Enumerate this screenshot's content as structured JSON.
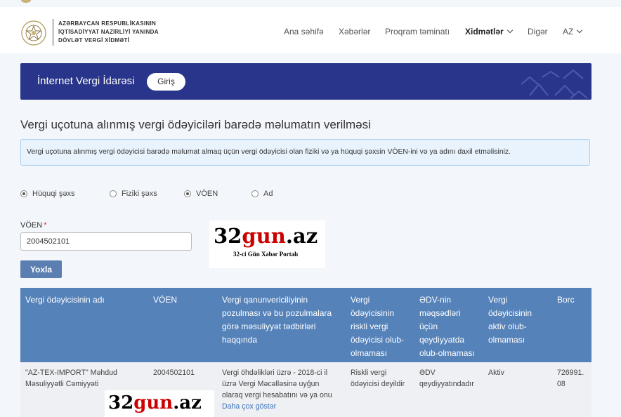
{
  "header": {
    "org_lines": [
      "AZƏRBAYCAN RESPUBLİKASININ",
      "İQTİSADİYYAT NAZİRLİYİ YANINDA",
      "DÖVLƏT VERGİ XİDMƏTİ"
    ],
    "nav": {
      "home": "Ana səhifə",
      "news": "Xəbərlər",
      "software": "Proqram təminatı",
      "services": "Xidmətlər",
      "other": "Digər",
      "language": "AZ"
    }
  },
  "banner": {
    "title": "İnternet Vergi İdarəsi",
    "login_label": "Giriş"
  },
  "page": {
    "title": "Vergi uçotuna alınmış vergi ödəyiciləri barədə məlumatın verilməsi",
    "info": "Vergi uçotuna alınmış vergi ödəyicisi barədə məlumat almaq üçün vergi ödəyicisi olan fiziki və ya hüquqi şəxsin VÖEN-ini və ya adını daxil etməlisiniz."
  },
  "filters": {
    "person_type": [
      {
        "label": "Hüquqi şəxs",
        "selected": true
      },
      {
        "label": "Fiziki şəxs",
        "selected": false
      }
    ],
    "search_by": [
      {
        "label": "VÖEN",
        "selected": true
      },
      {
        "label": "Ad",
        "selected": false
      }
    ]
  },
  "form": {
    "voen_label": "VÖEN",
    "required_mark": "*",
    "voen_value": "2004502101",
    "check_button": "Yoxla"
  },
  "watermark": {
    "brand_black": "32",
    "brand_red": "gun",
    "brand_tld": ".az",
    "tagline": "32-ci Gün Xəbər Portalı"
  },
  "table": {
    "headers": {
      "name": "Vergi ödəyicisinin adı",
      "voen": "VÖEN",
      "violation": [
        "Vergi qanunvericiliyinin",
        "pozulması və bu pozulmalara",
        "görə məsuliyyət tədbirləri",
        "haqqında"
      ],
      "risky": [
        "Vergi",
        "ödəyicisinin",
        "riskli vergi",
        "ödəyicisi olub-",
        "olmaması"
      ],
      "vat": [
        "ƏDV-nin",
        "məqsədləri",
        "üçün",
        "qeydiyyatda",
        "olub-olmaması"
      ],
      "active": [
        "Vergi",
        "ödəyicisinin",
        "aktiv olub-",
        "olmaması"
      ],
      "debt": "Borc"
    },
    "rows": [
      {
        "name": [
          "\"AZ-TEX-IMPORT\" Məhdud",
          "Məsuliyyətli Cəmiyyəti"
        ],
        "voen": "2004502101",
        "violation": [
          "Vergi öhdəlikləri üzrə - 2018-ci il",
          "üzrə Vergi Məcəlləsinə uyğun",
          "olaraq vergi hesabatını və ya onu"
        ],
        "more_link": "Daha çox göstər",
        "risky": [
          "Riskli vergi",
          "ödəyicisi deyildir"
        ],
        "vat": [
          "ƏDV",
          "qeydiyyatındadır"
        ],
        "active": "Aktiv",
        "debt": [
          "726991.",
          "08"
        ]
      }
    ]
  },
  "colors": {
    "banner": "#28358a",
    "table_header": "#5582b9",
    "button": "#5a7fb0",
    "link": "#3f72b8",
    "info_bg": "#e9f3fd",
    "info_border": "#a9cdf2"
  }
}
